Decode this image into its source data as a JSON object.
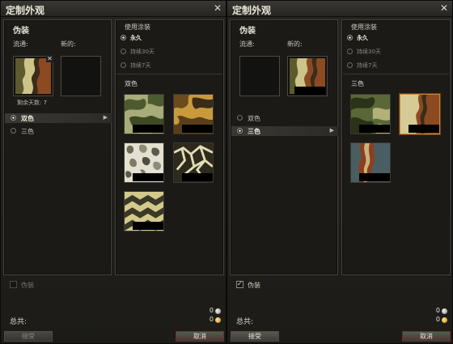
{
  "windows": [
    {
      "title": "定制外观",
      "section_title": "伪装",
      "current_label": "流通:",
      "new_label": "新的:",
      "remaining_days": "剩余天数: 7",
      "types": [
        {
          "label": "双色",
          "active": true,
          "arrow": "▶"
        },
        {
          "label": "三色",
          "active": false,
          "arrow": ""
        }
      ],
      "use_paint_label": "使用涂装",
      "options": [
        {
          "label": "永久",
          "selected": true
        },
        {
          "label": "持续30天",
          "selected": false
        },
        {
          "label": "持续7天",
          "selected": false
        }
      ],
      "group_label": "双色",
      "checkbox_label": "伪装",
      "checkbox_checked": false,
      "silver_value": "0",
      "gold_value": "0",
      "total_label": "总共:",
      "accept_label": "接受",
      "cancel_label": "取消"
    },
    {
      "title": "定制外观",
      "section_title": "伪装",
      "current_label": "流通:",
      "new_label": "新的:",
      "types": [
        {
          "label": "双色",
          "active": false,
          "arrow": ""
        },
        {
          "label": "三色",
          "active": true,
          "arrow": "▶"
        }
      ],
      "use_paint_label": "使用涂装",
      "options": [
        {
          "label": "永久",
          "selected": true
        },
        {
          "label": "持续30天",
          "selected": false
        },
        {
          "label": "持续7天",
          "selected": false
        }
      ],
      "group_label": "三色",
      "checkbox_label": "伪装",
      "checkbox_checked": true,
      "silver_value": "0",
      "gold_value": "0",
      "total_label": "总共:",
      "accept_label": "接受",
      "cancel_label": "取消"
    }
  ],
  "icons": {
    "close": "close-icon",
    "checkbox": "checkmark-icon",
    "silver": "silver-coin-icon",
    "gold": "gold-coin-icon",
    "arrow": "chevron-right-icon"
  },
  "colors": {
    "accent_selected_border": "#c8873a",
    "cancel_border": "#7a2a20",
    "background": "#1c1b18"
  }
}
